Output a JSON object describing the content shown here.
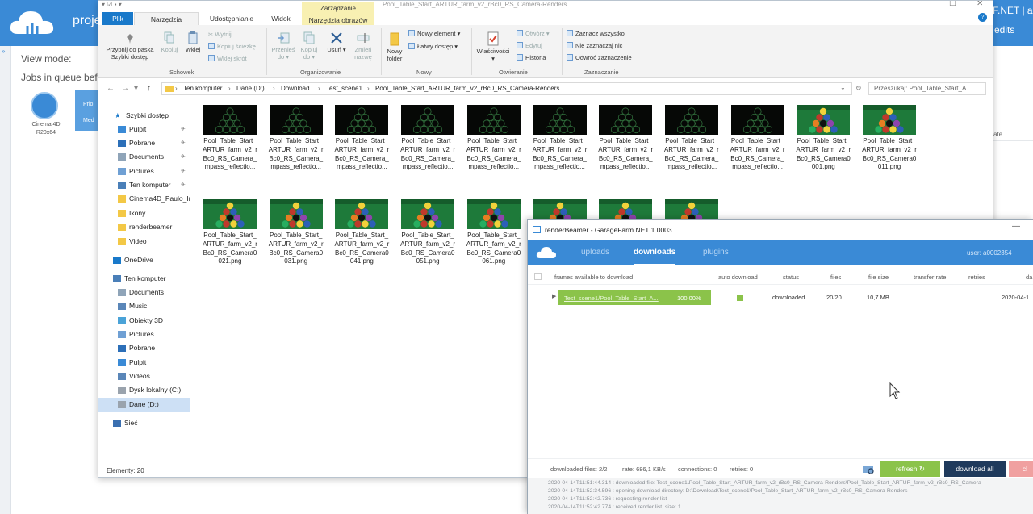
{
  "background_app": {
    "project_label": "proje",
    "brand_fragment": "F.NET | a",
    "credits_label": "edits",
    "view_mode_label": "View mode:",
    "jobs_label": "Jobs in queue bef",
    "job_app_label": "Cinema 4D",
    "job_app_sub": "R20x64",
    "priority_label": "Prio",
    "media_label": "Med",
    "right_col_label": "ate"
  },
  "explorer": {
    "title": "Pool_Table_Start_ARTUR_farm_v2_rBc0_RS_Camera-Renders",
    "tabs": [
      {
        "label": "Plik"
      },
      {
        "label": "Narzędzia główne"
      },
      {
        "label": "Udostępnianie"
      },
      {
        "label": "Widok"
      },
      {
        "label": "Narzędzia obrazów"
      }
    ],
    "manage_group_label": "Zarządzanie",
    "ribbon": {
      "pin_label": "Przypnij do paska Szybki dostęp",
      "copy_label": "Kopiuj",
      "paste_label": "Wklej",
      "cut_label": "Wytnij",
      "copy_path_label": "Kopiuj ścieżkę",
      "paste_shortcut_label": "Wklej skrót",
      "move_label": "Przenieś do",
      "copyto_label": "Kopiuj do",
      "delete_label": "Usuń",
      "rename_label": "Zmień nazwę",
      "new_folder_label": "Nowy folder",
      "new_item_label": "Nowy element",
      "easy_access_label": "Łatwy dostęp",
      "properties_label": "Właściwości",
      "open_label": "Otwórz",
      "edit_label": "Edytuj",
      "history_label": "Historia",
      "select_all_label": "Zaznacz wszystko",
      "select_none_label": "Nie zaznaczaj nic",
      "invert_label": "Odwróć zaznaczenie",
      "group_clipboard": "Schowek",
      "group_organize": "Organizowanie",
      "group_new": "Nowy",
      "group_open": "Otwieranie",
      "group_select": "Zaznaczanie"
    },
    "breadcrumb": [
      "Ten komputer",
      "Dane (D:)",
      "Download",
      "Test_scene1",
      "Pool_Table_Start_ARTUR_farm_v2_rBc0_RS_Camera-Renders"
    ],
    "search_placeholder": "Przeszukaj: Pool_Table_Start_A...",
    "nav": [
      {
        "label": "Szybki dostęp",
        "icon": "star-icon"
      },
      {
        "label": "Pulpit",
        "icon": "desktop-icon",
        "pinned": true
      },
      {
        "label": "Pobrane",
        "icon": "download-icon",
        "pinned": true
      },
      {
        "label": "Documents",
        "icon": "documents-icon",
        "pinned": true
      },
      {
        "label": "Pictures",
        "icon": "pictures-icon",
        "pinned": true
      },
      {
        "label": "Ten komputer",
        "icon": "computer-icon",
        "pinned": true
      },
      {
        "label": "Cinema4D_Paulo_Ir",
        "icon": "folder-icon"
      },
      {
        "label": "Ikony",
        "icon": "folder-icon"
      },
      {
        "label": "renderbeamer",
        "icon": "folder-icon"
      },
      {
        "label": "Video",
        "icon": "folder-icon"
      },
      {
        "label": "OneDrive",
        "icon": "cloud-icon"
      },
      {
        "label": "Ten komputer",
        "icon": "computer-icon"
      },
      {
        "label": "Documents",
        "icon": "documents-icon"
      },
      {
        "label": "Music",
        "icon": "music-icon"
      },
      {
        "label": "Obiekty 3D",
        "icon": "cube-icon"
      },
      {
        "label": "Pictures",
        "icon": "pictures-icon"
      },
      {
        "label": "Pobrane",
        "icon": "download-icon"
      },
      {
        "label": "Pulpit",
        "icon": "desktop-icon"
      },
      {
        "label": "Videos",
        "icon": "videos-icon"
      },
      {
        "label": "Dysk lokalny (C:)",
        "icon": "drive-icon"
      },
      {
        "label": "Dane (D:)",
        "icon": "drive-icon",
        "selected": true
      },
      {
        "label": "Sieć",
        "icon": "network-icon"
      }
    ],
    "files": [
      {
        "name": "Pool_Table_Start_\nARTUR_farm_v2_r\nBc0_RS_Camera_\nmpass_reflectio...",
        "thumb": "dark"
      },
      {
        "name": "Pool_Table_Start_\nARTUR_farm_v2_r\nBc0_RS_Camera_\nmpass_reflectio...",
        "thumb": "dark"
      },
      {
        "name": "Pool_Table_Start_\nARTUR_farm_v2_r\nBc0_RS_Camera_\nmpass_reflectio...",
        "thumb": "dark"
      },
      {
        "name": "Pool_Table_Start_\nARTUR_farm_v2_r\nBc0_RS_Camera_\nmpass_reflectio...",
        "thumb": "dark"
      },
      {
        "name": "Pool_Table_Start_\nARTUR_farm_v2_r\nBc0_RS_Camera_\nmpass_reflectio...",
        "thumb": "dark"
      },
      {
        "name": "Pool_Table_Start_\nARTUR_farm_v2_r\nBc0_RS_Camera_\nmpass_reflectio...",
        "thumb": "dark"
      },
      {
        "name": "Pool_Table_Start_\nARTUR_farm_v2_r\nBc0_RS_Camera_\nmpass_reflectio...",
        "thumb": "dark"
      },
      {
        "name": "Pool_Table_Start_\nARTUR_farm_v2_r\nBc0_RS_Camera_\nmpass_reflectio...",
        "thumb": "dark"
      },
      {
        "name": "Pool_Table_Start_\nARTUR_farm_v2_r\nBc0_RS_Camera_\nmpass_reflectio...",
        "thumb": "dark"
      },
      {
        "name": "Pool_Table_Start_\nARTUR_farm_v2_r\nBc0_RS_Camera0\n001.png",
        "thumb": "green"
      },
      {
        "name": "Pool_Table_Start_\nARTUR_farm_v2_r\nBc0_RS_Camera0\n011.png",
        "thumb": "green"
      },
      {
        "name": "Pool_Table_Start_\nARTUR_farm_v2_r\nBc0_RS_Camera0\n021.png",
        "thumb": "green"
      },
      {
        "name": "Pool_Table_Start_\nARTUR_farm_v2_r\nBc0_RS_Camera0\n031.png",
        "thumb": "green"
      },
      {
        "name": "Pool_Table_Start_\nARTUR_farm_v2_r\nBc0_RS_Camera0\n041.png",
        "thumb": "green"
      },
      {
        "name": "Pool_Table_Start_\nARTUR_farm_v2_r\nBc0_RS_Camera0\n051.png",
        "thumb": "green"
      },
      {
        "name": "Pool_Table_Start_\nARTUR_farm_v2_r\nBc0_RS_Camera0\n061.png",
        "thumb": "green"
      },
      {
        "name": "",
        "thumb": "green"
      },
      {
        "name": "",
        "thumb": "green"
      },
      {
        "name": "",
        "thumb": "green"
      }
    ],
    "status_text": "Elementy: 20"
  },
  "renderbeamer": {
    "title": "renderBeamer - GarageFarm.NET 1.0003",
    "tabs": [
      {
        "label": "uploads",
        "active": false
      },
      {
        "label": "downloads",
        "active": true
      },
      {
        "label": "plugins",
        "active": false
      }
    ],
    "user": "user: a0002354",
    "columns": [
      "frames available to download",
      "auto download",
      "status",
      "files",
      "file size",
      "transfer rate",
      "retries",
      "da"
    ],
    "rows": [
      {
        "name": "Test_scene1/Pool_Table_Start_A...",
        "progress_text": "100.00%",
        "progress": 1.0,
        "status": "downloaded",
        "files": "20/20",
        "size": "10,7 MB",
        "date": "2020-04-1"
      }
    ],
    "footer": {
      "downloaded_files": "downloaded files: 2/2",
      "rate": "rate: 686,1 KB/s",
      "connections": "connections: 0",
      "retries": "retries: 0",
      "refresh_label": "refresh",
      "download_all_label": "download all",
      "clear_label": "cl"
    },
    "log": [
      "2020-04-14T11:51:44.314 : downloaded file: Test_scene1\\Pool_Table_Start_ARTUR_farm_v2_rBc0_RS_Camera-Renders\\Pool_Table_Start_ARTUR_farm_v2_rBc0_RS_Camera",
      "2020-04-14T11:52:34.596 : opening download directory: D:\\Download\\Test_scene1\\Pool_Table_Start_ARTUR_farm_v2_rBc0_RS_Camera-Renders",
      "2020-04-14T11:52:42.736 : requesting render list",
      "2020-04-14T11:52:42.774 : received render list, size: 1"
    ],
    "colors": {
      "accent": "#3a8ad6",
      "green": "#8bc34a",
      "navy": "#1f3a5c"
    }
  }
}
